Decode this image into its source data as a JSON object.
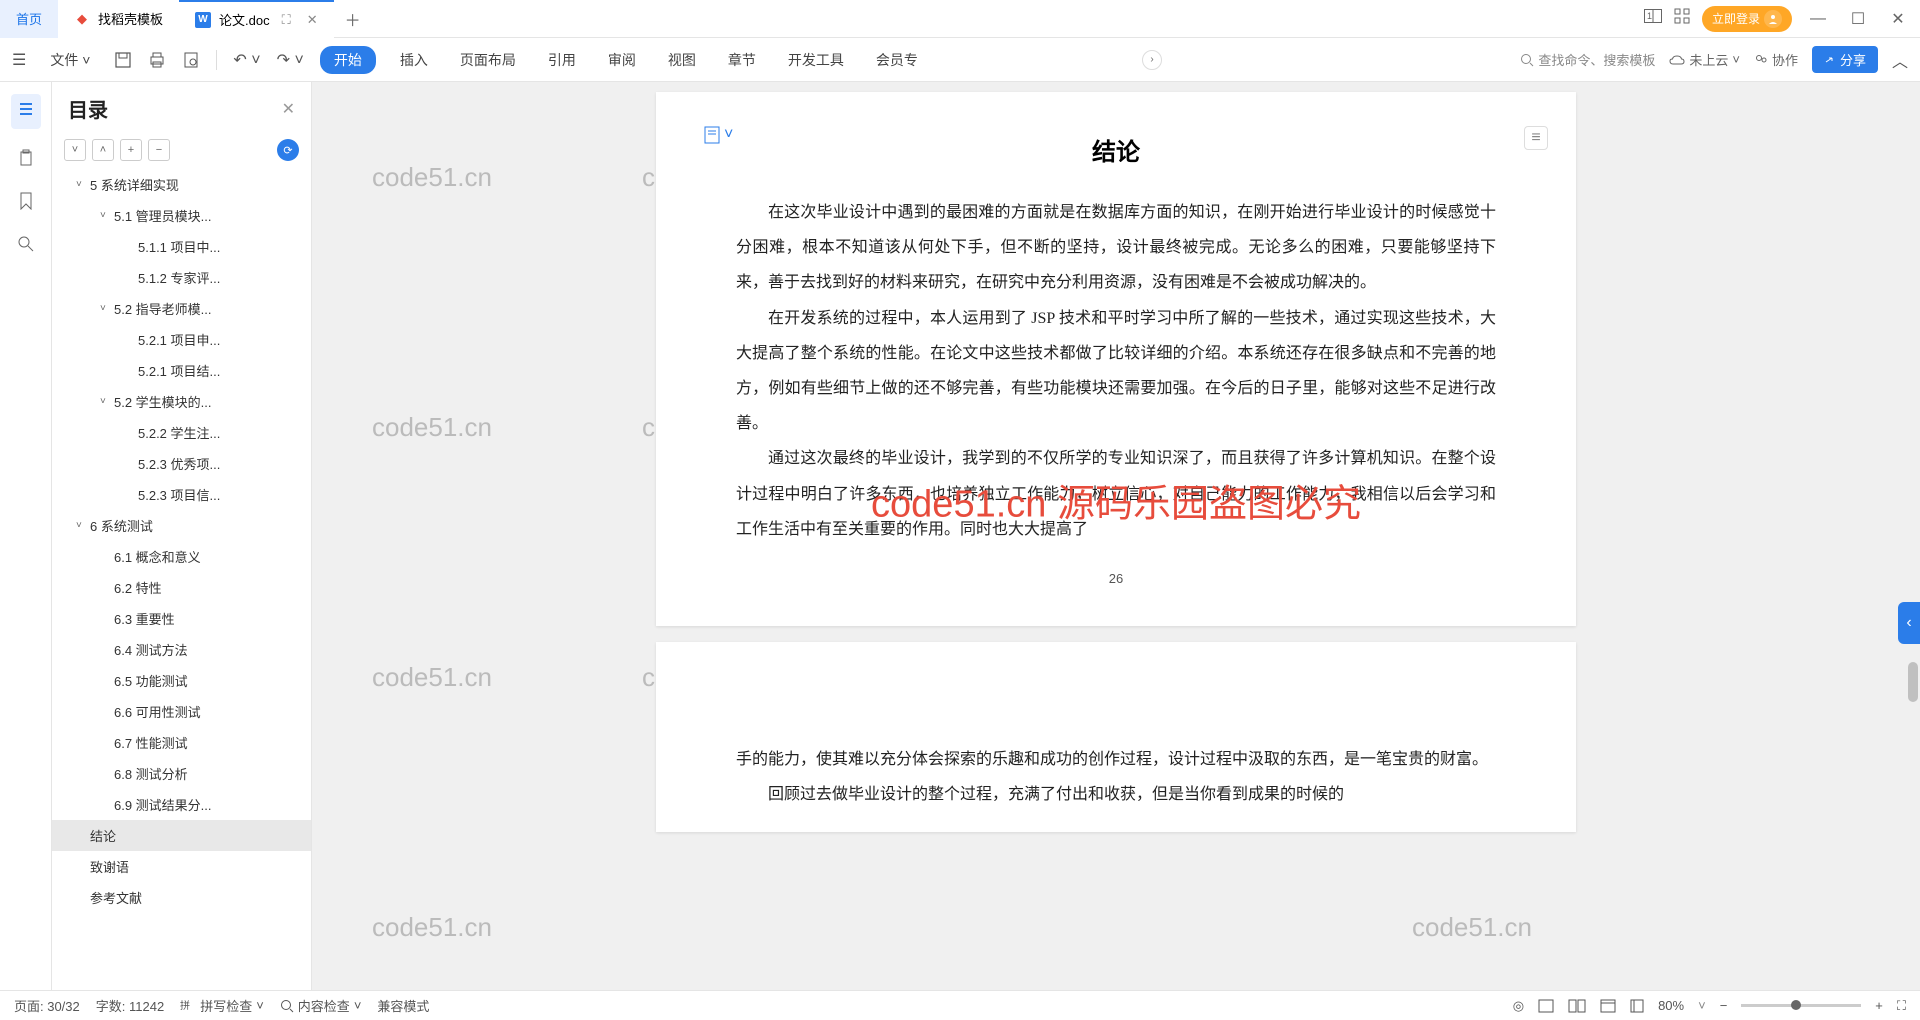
{
  "tabs": {
    "home": "首页",
    "template": "找稻壳模板",
    "doc": "论文.doc"
  },
  "titlebar": {
    "login": "立即登录"
  },
  "ribbon": {
    "file": "文件",
    "tabs": [
      "开始",
      "插入",
      "页面布局",
      "引用",
      "审阅",
      "视图",
      "章节",
      "开发工具",
      "会员专"
    ],
    "search_placeholder": "查找命令、搜索模板",
    "cloud": "未上云",
    "coop": "协作",
    "share": "分享"
  },
  "outline": {
    "title": "目录",
    "items": [
      {
        "indent": 1,
        "chev": "v",
        "label": "5 系统详细实现"
      },
      {
        "indent": 2,
        "chev": "v",
        "label": "5.1 管理员模块..."
      },
      {
        "indent": 3,
        "chev": "",
        "label": "5.1.1 项目中..."
      },
      {
        "indent": 3,
        "chev": "",
        "label": "5.1.2 专家评..."
      },
      {
        "indent": 2,
        "chev": "v",
        "label": "5.2 指导老师模..."
      },
      {
        "indent": 3,
        "chev": "",
        "label": "5.2.1 项目申..."
      },
      {
        "indent": 3,
        "chev": "",
        "label": "5.2.1 项目结..."
      },
      {
        "indent": 2,
        "chev": "v",
        "label": "5.2 学生模块的..."
      },
      {
        "indent": 3,
        "chev": "",
        "label": "5.2.2 学生注..."
      },
      {
        "indent": 3,
        "chev": "",
        "label": "5.2.3 优秀项..."
      },
      {
        "indent": 3,
        "chev": "",
        "label": "5.2.3 项目信..."
      },
      {
        "indent": 1,
        "chev": "v",
        "label": "6 系统测试"
      },
      {
        "indent": 2,
        "chev": "",
        "label": "6.1 概念和意义"
      },
      {
        "indent": 2,
        "chev": "",
        "label": "6.2 特性"
      },
      {
        "indent": 2,
        "chev": "",
        "label": "6.3 重要性"
      },
      {
        "indent": 2,
        "chev": "",
        "label": "6.4 测试方法"
      },
      {
        "indent": 2,
        "chev": "",
        "label": "6.5 功能测试"
      },
      {
        "indent": 2,
        "chev": "",
        "label": "6.6 可用性测试"
      },
      {
        "indent": 2,
        "chev": "",
        "label": "6.7 性能测试"
      },
      {
        "indent": 2,
        "chev": "",
        "label": "6.8 测试分析"
      },
      {
        "indent": 2,
        "chev": "",
        "label": "6.9 测试结果分..."
      },
      {
        "indent": 1,
        "chev": "",
        "label": "结论",
        "active": true
      },
      {
        "indent": 1,
        "chev": "",
        "label": "致谢语"
      },
      {
        "indent": 1,
        "chev": "",
        "label": "参考文献"
      }
    ]
  },
  "document": {
    "heading": "结论",
    "p1": "在这次毕业设计中遇到的最困难的方面就是在数据库方面的知识，在刚开始进行毕业设计的时候感觉十分困难，根本不知道该从何处下手，但不断的坚持，设计最终被完成。无论多么的困难，只要能够坚持下来，善于去找到好的材料来研究，在研究中充分利用资源，没有困难是不会被成功解决的。",
    "p2": "在开发系统的过程中，本人运用到了 JSP 技术和平时学习中所了解的一些技术，通过实现这些技术，大大提高了整个系统的性能。在论文中这些技术都做了比较详细的介绍。本系统还存在很多缺点和不完善的地方，例如有些细节上做的还不够完善，有些功能模块还需要加强。在今后的日子里，能够对这些不足进行改善。",
    "p3": "通过这次最终的毕业设计，我学到的不仅所学的专业知识深了，而且获得了许多计算机知识。在整个设计过程中明白了许多东西，也培养独立工作能力，树立信心，对自己能力的工作能力，我相信以后会学习和工作生活中有至关重要的作用。同时也大大提高了",
    "page_num": "26",
    "p4": "手的能力，使其难以充分体会探索的乐趣和成功的创作过程，设计过程中汲取的东西，是一笔宝贵的财富。",
    "p5": "回顾过去做毕业设计的整个过程，充满了付出和收获，但是当你看到成果的时候的"
  },
  "watermark": {
    "text": "code51.cn",
    "overlay": "code51.cn 源码乐园盗图必究"
  },
  "statusbar": {
    "page": "页面: 30/32",
    "words": "字数: 11242",
    "spellcheck": "拼写检查",
    "contentcheck": "内容检查",
    "compat": "兼容模式",
    "zoom": "80%"
  }
}
